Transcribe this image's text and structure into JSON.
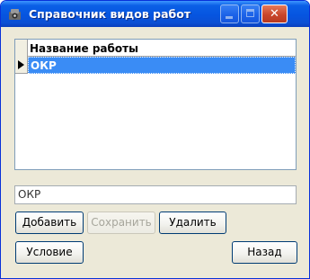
{
  "window": {
    "title": "Справочник видов работ",
    "icon": "app-icon",
    "controls": {
      "minimize": "minimize-icon",
      "maximize": "maximize-icon",
      "close": "close-icon",
      "close_glyph": "✕"
    }
  },
  "grid": {
    "columns": [
      "Название работы"
    ],
    "rows": [
      {
        "name": "ОКР",
        "selected": true
      }
    ]
  },
  "detail": {
    "value": "ОКР"
  },
  "buttons": {
    "add": "Добавить",
    "save": "Сохранить",
    "delete": "Удалить",
    "condition": "Условие",
    "back": "Назад"
  },
  "colors": {
    "titlebar": "#0655e0",
    "selection": "#3a8cf5",
    "window_bg": "#ece9d8"
  }
}
